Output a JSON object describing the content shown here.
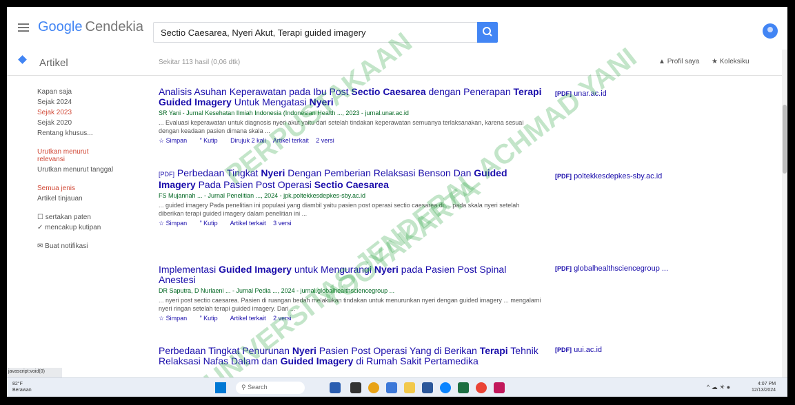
{
  "header": {
    "logo_google": "Google",
    "logo_product": "Cendekia",
    "search_value": "Sectio Caesarea, Nyeri Akut, Terapi guided imagery"
  },
  "subbar": {
    "tab": "Artikel",
    "result_count": "Sekitar 113 hasil (0,06 dtk)",
    "profile": "Profil saya",
    "library": "Koleksiku"
  },
  "sidebar": {
    "time_filters": [
      "Kapan saja",
      "Sejak 2024",
      "Sejak 2023",
      "Sejak 2020",
      "Rentang khusus..."
    ],
    "sort": [
      "Urutkan menurut relevansi",
      "Urutkan menurut tanggal"
    ],
    "types": [
      "Semua jenis",
      "Artikel tinjauan"
    ],
    "checks": [
      "sertakan paten",
      "mencakup kutipan"
    ],
    "alert": "Buat notifikasi"
  },
  "results": [
    {
      "title_parts": [
        "Analisis Asuhan Keperawatan pada Ibu Post ",
        "Sectio Caesarea",
        " dengan Penerapan ",
        "Terapi Guided Imagery",
        " Untuk Mengatasi ",
        "Nyeri"
      ],
      "meta": "SR Yani - Jurnal Kesehatan Ilmiah Indonesia (Indonesian Health ..., 2023 - jurnal.unar.ac.id",
      "snippet": "... Evaluasi keperawatan untuk diagnosis nyeri akut yaitu dari setelah tindakan keperawatan semuanya terlaksanakan, karena sesuai dengan keadaan pasien dimana skala ...",
      "actions": [
        "Simpan",
        "Kutip",
        "Dirujuk 2 kali",
        "Artikel terkait",
        "2 versi"
      ],
      "pdf_tag": "[PDF]",
      "pdf_source": "unar.ac.id"
    },
    {
      "title_prefix": "[PDF]",
      "title_parts": [
        " Perbedaan Tingkat ",
        "Nyeri",
        " Dengan Pemberian Relaksasi Benson Dan ",
        "Guided Imagery",
        " Pada Pasien Post Operasi ",
        "Sectio Caesarea"
      ],
      "meta": "FS Mujannah ... - Jurnal Penelitian ..., 2024 - jpk.poltekkesdepkes-sby.ac.id",
      "snippet": "... guided imagery Pada penelitian ini populasi yang diambil yaitu pasien post operasi sectio caesarea di ... pada skala nyeri setelah diberikan terapi guided imagery dalam penelitian ini ...",
      "actions": [
        "Simpan",
        "Kutip",
        "Artikel terkait",
        "3 versi"
      ],
      "pdf_tag": "[PDF]",
      "pdf_source": "poltekkesdepkes-sby.ac.id"
    },
    {
      "title_parts": [
        "Implementasi ",
        "Guided Imagery",
        " untuk Mengurangi ",
        "Nyeri",
        " pada Pasien Post Spinal Anestesi"
      ],
      "meta": "DR Saputra, D Nurlaeni ... - Jurnal Pedia ..., 2024 - jurnal.globalhealthsciencegroup ...",
      "snippet": "... nyeri post sectio caesarea. Pasien di ruangan bedah melakukan tindakan untuk menurunkan nyeri dengan guided imagery ... mengalami nyeri ringan setelah terapi guided imagery. Dari ...",
      "actions": [
        "Simpan",
        "Kutip",
        "Artikel terkait",
        "2 versi"
      ],
      "pdf_tag": "[PDF]",
      "pdf_source": "globalhealthsciencegroup ..."
    },
    {
      "title_parts": [
        "Perbedaan Tingkat Penurunan ",
        "Nyeri",
        " Pasien Post Operasi Yang di Berikan ",
        "Terapi",
        " Tehnik Relaksasi Nafas Dalam dan ",
        "Guided Imagery",
        " di Rumah Sakit Pertamedika"
      ],
      "pdf_tag": "[PDF]",
      "pdf_source": "uui.ac.id"
    }
  ],
  "watermark": {
    "lines": [
      "UNIVERSITAS JENDERAL ACHMAD YANI",
      "YOGYAKARTA",
      "PERPUSTAKAAN"
    ]
  },
  "statusbar": {
    "url": "javascript:void(0)"
  },
  "taskbar": {
    "weather_temp": "82°F",
    "weather_desc": "Berawan",
    "search": "Search",
    "time": "4:07 PM",
    "date": "12/13/2024"
  }
}
